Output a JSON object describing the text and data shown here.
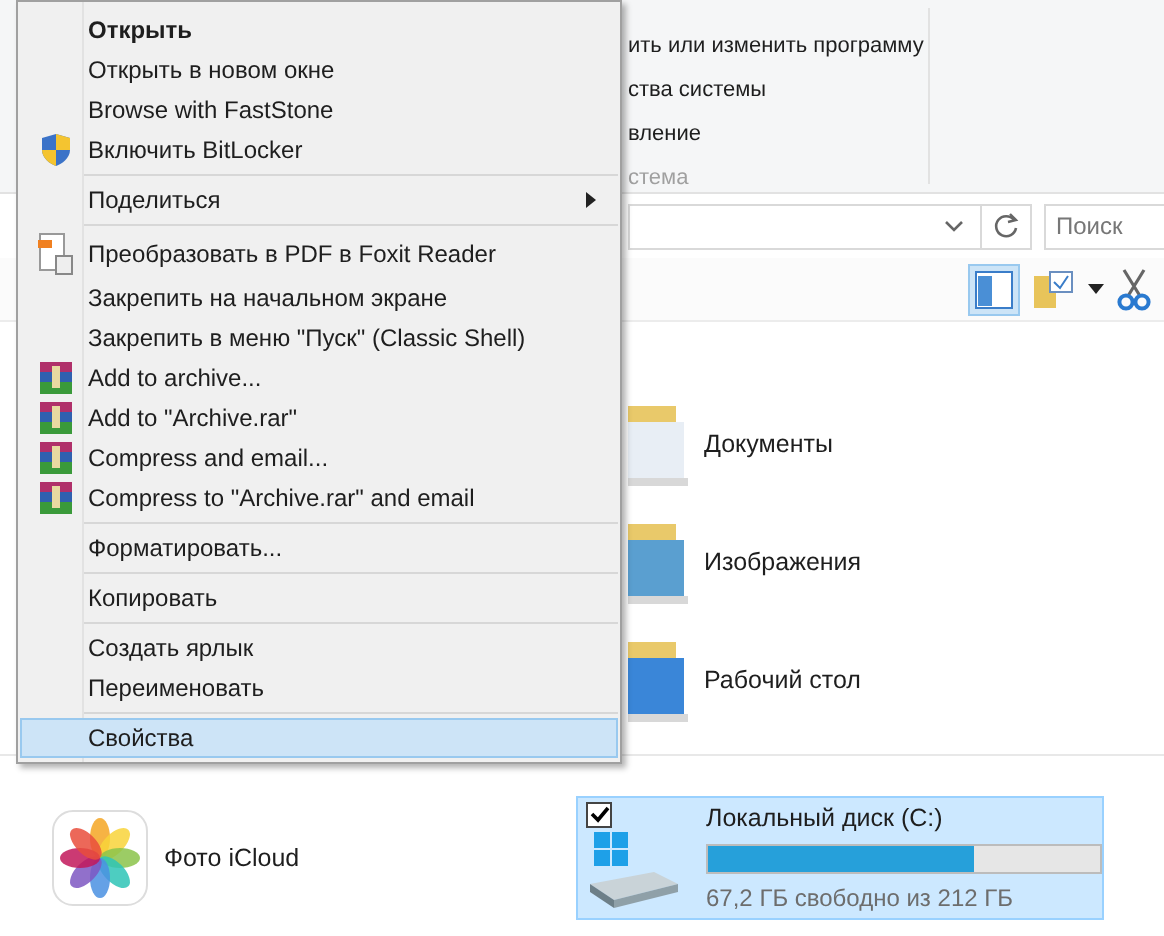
{
  "ribbon": {
    "commands": [
      "ить или изменить программу",
      "ства системы",
      "вление"
    ],
    "group_label": "стема"
  },
  "address_bar": {
    "search_placeholder": "Поиск"
  },
  "toolbar": {
    "preview_pane_selected": true
  },
  "folders": [
    {
      "name": "Документы",
      "kind": "documents"
    },
    {
      "name": "Изображения",
      "kind": "pictures"
    },
    {
      "name": "Рабочий стол",
      "kind": "desktop"
    }
  ],
  "devices": [
    {
      "kind": "app",
      "name": "Фото iCloud"
    },
    {
      "kind": "drive",
      "name": "Локальный диск (C:)",
      "selected": true,
      "checked": true,
      "level": 0.68,
      "free": "67,2 ГБ свободно из 212 ГБ"
    }
  ],
  "context_menu": [
    {
      "kind": "item",
      "label": "Открыть",
      "bold": true,
      "selected": false
    },
    {
      "kind": "item",
      "label": "Открыть в новом окне",
      "selected": false
    },
    {
      "kind": "item",
      "label": "Browse with FastStone",
      "selected": false
    },
    {
      "kind": "shield",
      "label": "Включить BitLocker",
      "selected": false
    },
    {
      "kind": "separator"
    },
    {
      "kind": "item",
      "label": "Поделиться",
      "submenu": true,
      "selected": false
    },
    {
      "kind": "separator"
    },
    {
      "kind": "pdf",
      "label": "Преобразовать в PDF в Foxit Reader",
      "selected": false
    },
    {
      "kind": "item",
      "label": "Закрепить на начальном экране",
      "selected": false
    },
    {
      "kind": "item",
      "label": "Закрепить в меню \"Пуск\" (Classic Shell)",
      "selected": false
    },
    {
      "kind": "archive",
      "label": "Add to archive...",
      "selected": false
    },
    {
      "kind": "archive",
      "label": "Add to \"Archive.rar\"",
      "selected": false
    },
    {
      "kind": "archive",
      "label": "Compress and email...",
      "selected": false
    },
    {
      "kind": "archive",
      "label": "Compress to \"Archive.rar\" and email",
      "selected": false
    },
    {
      "kind": "separator"
    },
    {
      "kind": "item",
      "label": "Форматировать...",
      "selected": false
    },
    {
      "kind": "separator"
    },
    {
      "kind": "item",
      "label": "Копировать",
      "selected": false
    },
    {
      "kind": "separator"
    },
    {
      "kind": "item",
      "label": "Создать ярлык",
      "selected": false
    },
    {
      "kind": "item",
      "label": "Переименовать",
      "selected": false
    },
    {
      "kind": "separator"
    },
    {
      "kind": "item",
      "label": "Свойства",
      "selected": true
    }
  ]
}
